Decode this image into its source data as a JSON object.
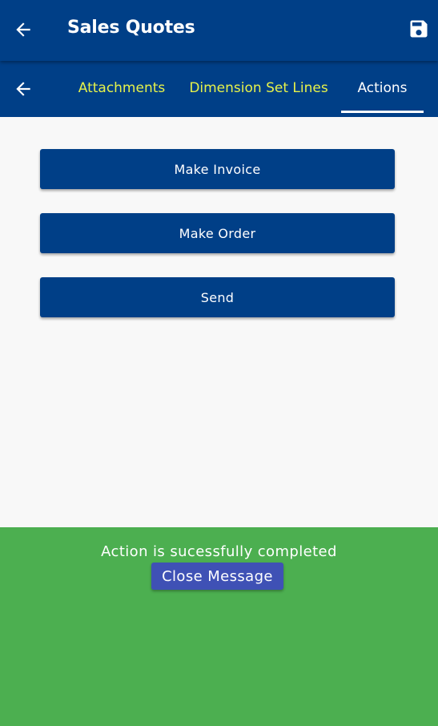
{
  "colors": {
    "primary": "#003f87",
    "tab_inactive": "#e6f24a",
    "tab_active": "#ffffff",
    "background": "#f8f8f8",
    "success": "#4caf50",
    "close_button": "#3f51b5"
  },
  "header": {
    "back_icon": "arrow-left-icon",
    "title": "Sales Quotes",
    "save_icon": "floppy-disk-icon"
  },
  "tabs": {
    "back_icon": "arrow-left-icon",
    "items": [
      {
        "label": "Attachments",
        "active": false
      },
      {
        "label": "Dimension Set Lines",
        "active": false
      },
      {
        "label": "Actions",
        "active": true
      }
    ]
  },
  "actions": [
    {
      "label": "Make Invoice"
    },
    {
      "label": "Make Order"
    },
    {
      "label": "Send"
    }
  ],
  "message": {
    "text": "Action is sucessfully completed",
    "close_label": "Close Message"
  }
}
